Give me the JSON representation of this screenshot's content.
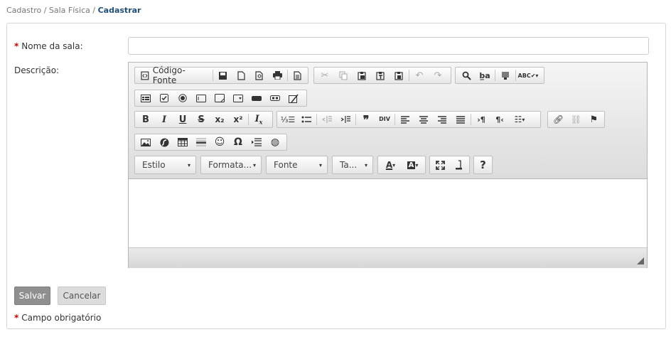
{
  "breadcrumb": {
    "item1": "Cadastro",
    "sep": " / ",
    "item2": "Sala Física",
    "current": "Cadastrar"
  },
  "form": {
    "required_marker": "*",
    "name_label": "Nome da sala:",
    "name_value": "",
    "description_label": "Descrição:",
    "required_note": "Campo obrigatório"
  },
  "editor": {
    "source_label": "Código-Fonte",
    "combos": {
      "style": "Estilo",
      "format": "Formata...",
      "font": "Fonte",
      "size": "Ta..."
    },
    "icons": [
      "source-icon",
      "save-icon",
      "new-page-icon",
      "preview-icon",
      "print-icon",
      "templates-icon",
      "cut-icon",
      "copy-icon",
      "paste-icon",
      "paste-text-icon",
      "paste-word-icon",
      "undo-icon",
      "redo-icon",
      "find-icon",
      "replace-icon",
      "select-all-icon",
      "spellcheck-icon",
      "form-icon",
      "checkbox-icon",
      "radio-icon",
      "textfield-icon",
      "textarea-icon",
      "select-icon",
      "button-icon",
      "imagebutton-icon",
      "hiddenfield-icon",
      "bold-icon",
      "italic-icon",
      "underline-icon",
      "strike-icon",
      "subscript-icon",
      "superscript-icon",
      "remove-format-icon",
      "numbered-list-icon",
      "bulleted-list-icon",
      "outdent-icon",
      "indent-icon",
      "blockquote-icon",
      "create-div-icon",
      "align-left-icon",
      "align-center-icon",
      "align-right-icon",
      "justify-icon",
      "ltr-icon",
      "rtl-icon",
      "language-icon",
      "link-icon",
      "unlink-icon",
      "anchor-icon",
      "image-icon",
      "flash-icon",
      "table-icon",
      "horizontal-rule-icon",
      "smiley-icon",
      "special-char-icon",
      "page-break-icon",
      "iframe-icon",
      "text-color-icon",
      "bg-color-icon",
      "maximize-icon",
      "show-blocks-icon",
      "help-icon"
    ]
  },
  "buttons": {
    "save": "Salvar",
    "cancel": "Cancelar"
  }
}
